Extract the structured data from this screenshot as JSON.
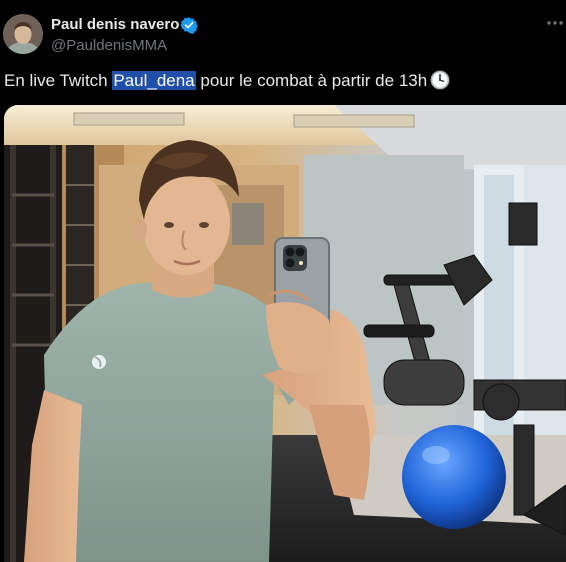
{
  "author": {
    "display_name": "Paul denis navero",
    "handle": "@PauldenisMMA",
    "verified": true,
    "avatar_icon": "avatar-photo"
  },
  "menu": {
    "more_icon": "more-horizontal-icon"
  },
  "tweet": {
    "text_before": "En live Twitch ",
    "mention": "Paul_dena",
    "text_after": " pour le combat à partir de 13h",
    "emoji_icon": "clock-emoji"
  },
  "media": {
    "type": "photo",
    "description_icon": "gym-mirror-selfie-photo"
  },
  "colors": {
    "background": "#000000",
    "text_primary": "#e7e9ea",
    "text_secondary": "#71767b",
    "verified_blue": "#1d9bf0",
    "mention_highlight": "#1f4fa8"
  }
}
